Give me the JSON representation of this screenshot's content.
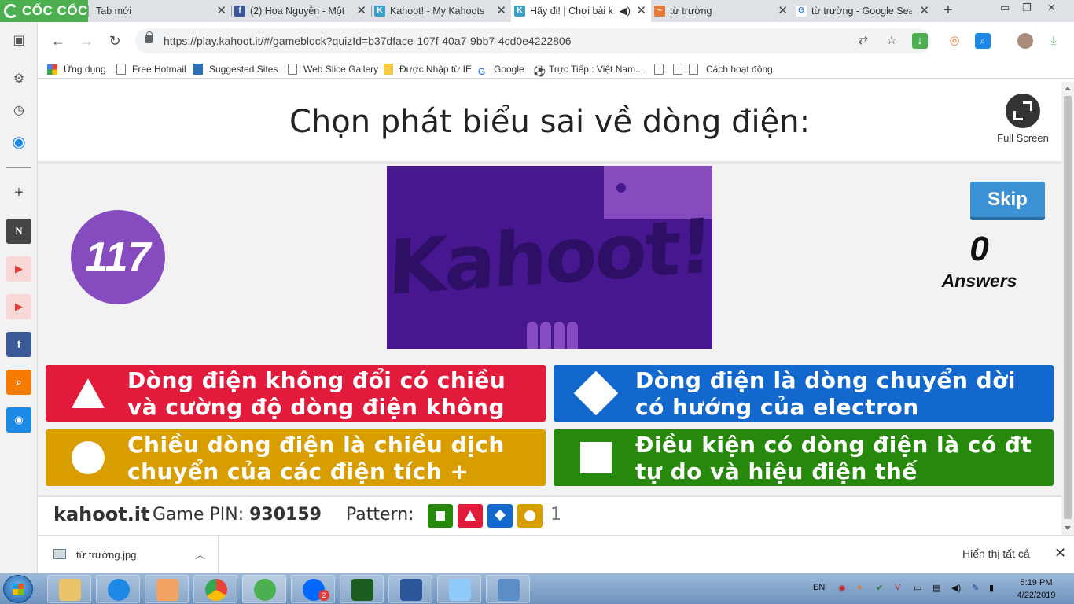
{
  "browser": {
    "brand": "CỐC CỐC",
    "tabs": [
      {
        "title": "Tab mới",
        "active": false
      },
      {
        "title": "(2) Hoa Nguyễn - Một",
        "active": false
      },
      {
        "title": "Kahoot! - My Kahoots",
        "active": false
      },
      {
        "title": "Hãy đi! | Chơi bài k",
        "active": true
      },
      {
        "title": "từ trường",
        "active": false
      },
      {
        "title": "từ trường - Google Sea",
        "active": false
      }
    ],
    "url": "https://play.kahoot.it/#/gameblock?quizId=b37dface-107f-40a7-9bb7-4cd0e4222806",
    "bookmarks": [
      "Ứng dụng",
      "Free Hotmail",
      "Suggested Sites",
      "Web Slice Gallery",
      "Được Nhập từ IE",
      "Google",
      "Trực Tiếp : Việt Nam...",
      "",
      "Cách hoạt động"
    ]
  },
  "kahoot": {
    "question": "Chọn phát biểu sai về dòng điện:",
    "fullscreen_label": "Full Screen",
    "timer": "117",
    "media_logo": "Kahoot!",
    "skip_label": "Skip",
    "answers_count": "0",
    "answers_label": "Answers",
    "answers": [
      {
        "shape": "triangle",
        "color": "#e21b3c",
        "text": "Dòng điện không đổi có chiều và cường độ dòng điện không đổi"
      },
      {
        "shape": "diamond",
        "color": "#1368ce",
        "text": "Dòng điện là dòng chuyển dời có hướng của electron"
      },
      {
        "shape": "circle",
        "color": "#d89e00",
        "text": "Chiều dòng điện là chiều dịch chuyển của các điện tích +"
      },
      {
        "shape": "square",
        "color": "#26890c",
        "text": "Điều kiện có dòng điện là có đt tự do và hiệu điện thế"
      }
    ],
    "footer": {
      "brand": "kahoot.it",
      "pin_label": "Game PIN:",
      "pin": "930159",
      "pattern_label": "Pattern:",
      "pattern": [
        "square",
        "triangle",
        "diamond",
        "circle"
      ],
      "pattern_count": "1"
    }
  },
  "downloads": {
    "file": "từ trường.jpg",
    "show_all": "Hiển thị tất cả"
  },
  "taskbar": {
    "lang": "EN",
    "time": "5:19 PM",
    "date": "4/22/2019",
    "zalo_badge": "2"
  }
}
